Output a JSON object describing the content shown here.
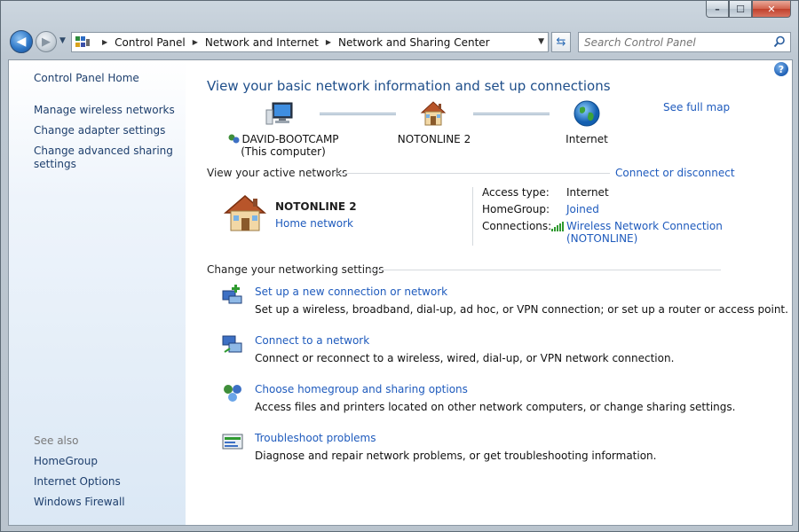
{
  "window": {
    "caption": {
      "minimize": "–",
      "maximize": "☐",
      "close": "✕"
    }
  },
  "navbar": {
    "back_label": "◀",
    "forward_label": "▶",
    "breadcrumb": [
      "Control Panel",
      "Network and Internet",
      "Network and Sharing Center"
    ],
    "search_placeholder": "Search Control Panel"
  },
  "sidebar": {
    "home": "Control Panel Home",
    "links": [
      "Manage wireless networks",
      "Change adapter settings",
      "Change advanced sharing settings"
    ],
    "see_also_label": "See also",
    "see_also": [
      "HomeGroup",
      "Internet Options",
      "Windows Firewall"
    ]
  },
  "main": {
    "title": "View your basic network information and set up connections",
    "see_full_map": "See full map",
    "map": {
      "computer_name": "DAVID-BOOTCAMP",
      "computer_sub": "(This computer)",
      "network_name": "NOTONLINE  2",
      "internet": "Internet"
    },
    "active": {
      "header": "View your active networks",
      "connect_link": "Connect or disconnect",
      "network_name": "NOTONLINE  2",
      "network_type": "Home network",
      "access_type_label": "Access type:",
      "access_type_value": "Internet",
      "homegroup_label": "HomeGroup:",
      "homegroup_value": "Joined",
      "connections_label": "Connections:",
      "connections_value_1": "Wireless Network Connection",
      "connections_value_2": "(NOTONLINE)"
    },
    "settings": {
      "header": "Change your networking settings",
      "tasks": [
        {
          "link": "Set up a new connection or network",
          "desc": "Set up a wireless, broadband, dial-up, ad hoc, or VPN connection; or set up a router or access point."
        },
        {
          "link": "Connect to a network",
          "desc": "Connect or reconnect to a wireless, wired, dial-up, or VPN network connection."
        },
        {
          "link": "Choose homegroup and sharing options",
          "desc": "Access files and printers located on other network computers, or change sharing settings."
        },
        {
          "link": "Troubleshoot problems",
          "desc": "Diagnose and repair network problems, or get troubleshooting information."
        }
      ]
    }
  },
  "colors": {
    "link": "#1f5bbd",
    "title": "#1e4e8a",
    "sidebar_link": "#1e3f6d"
  }
}
